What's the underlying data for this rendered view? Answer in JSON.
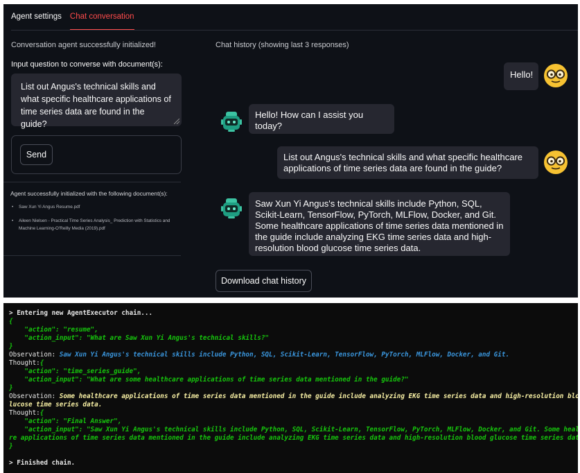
{
  "tabs": [
    {
      "label": "Agent settings",
      "active": false
    },
    {
      "label": "Chat conversation",
      "active": true
    }
  ],
  "left_panel": {
    "status": "Conversation agent successfully initialized!",
    "input_label": "Input question to converse with document(s):",
    "question_value": "List out Angus's technical skills and what specific healthcare applications of time series data are found in the guide?",
    "send_label": "Send",
    "docs_title": "Agent successfully initialized with the following document(s):",
    "documents": [
      "Saw Xun Yi Angus Resume.pdf",
      "Aileen Nielsen - Practical Time Series Analysis_ Prediction with Statistics and Machine Learning-O'Reilly Media (2019).pdf"
    ]
  },
  "chat": {
    "header": "Chat history (showing last 3 responses)",
    "messages": [
      {
        "role": "user",
        "text": "Hello!"
      },
      {
        "role": "assistant",
        "text": "Hello! How can I assist you today?"
      },
      {
        "role": "user",
        "text": "List out Angus's technical skills and what specific healthcare applications of time series data are found in the guide?"
      },
      {
        "role": "assistant",
        "text": "Saw Xun Yi Angus's technical skills include Python, SQL, Scikit-Learn, TensorFlow, PyTorch, MLFlow, Docker, and Git. Some healthcare applications of time series data mentioned in the guide include analyzing EKG time series data and high-resolution blood glucose time series data."
      }
    ],
    "download_label": "Download chat history"
  },
  "terminal": {
    "lines": [
      {
        "parts": [
          {
            "c": "white",
            "t": "> Entering new AgentExecutor chain..."
          }
        ]
      },
      {
        "parts": [
          {
            "c": "green",
            "t": "{"
          }
        ]
      },
      {
        "parts": [
          {
            "c": "green",
            "t": "    \"action\": \"resume\","
          }
        ]
      },
      {
        "parts": [
          {
            "c": "green",
            "t": "    \"action_input\": \"What are Saw Xun Yi Angus's technical skills?\""
          }
        ]
      },
      {
        "parts": [
          {
            "c": "green",
            "t": "}"
          }
        ]
      },
      {
        "parts": [
          {
            "c": "plain",
            "t": "Observation: "
          },
          {
            "c": "cyan",
            "t": "Saw Xun Yi Angus's technical skills include Python, SQL, Scikit-Learn, TensorFlow, PyTorch, MLFlow, Docker, and Git."
          }
        ]
      },
      {
        "parts": [
          {
            "c": "plain",
            "t": "Thought:"
          },
          {
            "c": "green",
            "t": "{"
          }
        ]
      },
      {
        "parts": [
          {
            "c": "green",
            "t": "    \"action\": \"time_series_guide\","
          }
        ]
      },
      {
        "parts": [
          {
            "c": "green",
            "t": "    \"action_input\": \"What are some healthcare applications of time series data mentioned in the guide?\""
          }
        ]
      },
      {
        "parts": [
          {
            "c": "green",
            "t": "}"
          }
        ]
      },
      {
        "parts": [
          {
            "c": "plain",
            "t": "Observation: "
          },
          {
            "c": "yellow",
            "t": "Some healthcare applications of time series data mentioned in the guide include analyzing EKG time series data and high-resolution blood g"
          }
        ]
      },
      {
        "parts": [
          {
            "c": "yellow",
            "t": "lucose time series data."
          }
        ]
      },
      {
        "parts": [
          {
            "c": "plain",
            "t": "Thought:"
          },
          {
            "c": "green",
            "t": "{"
          }
        ]
      },
      {
        "parts": [
          {
            "c": "green",
            "t": "    \"action\": \"Final Answer\","
          }
        ]
      },
      {
        "parts": [
          {
            "c": "green",
            "t": "    \"action_input\": \"Saw Xun Yi Angus's technical skills include Python, SQL, Scikit-Learn, TensorFlow, PyTorch, MLFlow, Docker, and Git. Some healthca"
          }
        ]
      },
      {
        "parts": [
          {
            "c": "green",
            "t": "re applications of time series data mentioned in the guide include analyzing EKG time series data and high-resolution blood glucose time series data.\""
          }
        ]
      },
      {
        "parts": [
          {
            "c": "green",
            "t": "}"
          }
        ]
      },
      {
        "parts": [
          {
            "c": "plain",
            "t": ""
          }
        ]
      },
      {
        "parts": [
          {
            "c": "white",
            "t": "> Finished chain."
          }
        ]
      }
    ]
  }
}
